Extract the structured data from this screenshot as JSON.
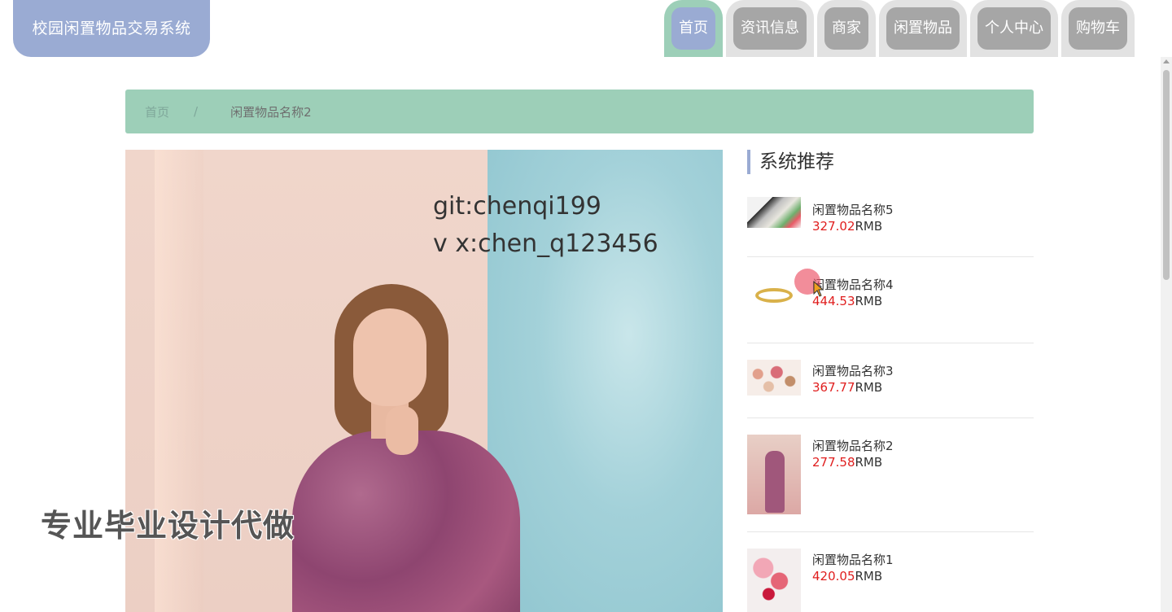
{
  "app": {
    "title": "校园闲置物品交易系统"
  },
  "nav": {
    "items": [
      {
        "label": "首页",
        "active": true
      },
      {
        "label": "资讯信息",
        "active": false
      },
      {
        "label": "商家",
        "active": false
      },
      {
        "label": "闲置物品",
        "active": false
      },
      {
        "label": "个人中心",
        "active": false
      },
      {
        "label": "购物车",
        "active": false
      }
    ]
  },
  "breadcrumb": {
    "home": "首页",
    "separator": "/",
    "current": "闲置物品名称2"
  },
  "main_image": {
    "watermark_line1": "git:chenqi199",
    "watermark_line2": "v x:chen_q123456",
    "overlay_text": "专业毕业设计代做"
  },
  "recommend": {
    "title": "系统推荐",
    "items": [
      {
        "name": "闲置物品名称5",
        "price": "327.02",
        "unit": "RMB",
        "thumb": "desk-items"
      },
      {
        "name": "闲置物品名称4",
        "price": "444.53",
        "unit": "RMB",
        "thumb": "gold-ring"
      },
      {
        "name": "闲置物品名称3",
        "price": "367.77",
        "unit": "RMB",
        "thumb": "cosmetics"
      },
      {
        "name": "闲置物品名称2",
        "price": "277.58",
        "unit": "RMB",
        "thumb": "dress"
      },
      {
        "name": "闲置物品名称1",
        "price": "420.05",
        "unit": "RMB",
        "thumb": "flowers"
      }
    ]
  },
  "colors": {
    "accent_blue": "#9aabd3",
    "accent_green": "#9dcfb8",
    "price_red": "#e01e1e",
    "nav_gray": "#a6a6a6"
  }
}
